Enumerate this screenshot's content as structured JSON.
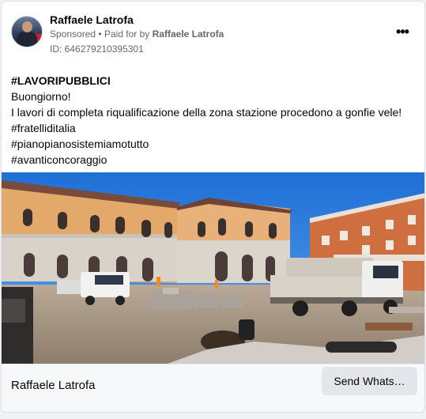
{
  "ad": {
    "page_name": "Raffaele Latrofa",
    "sponsored_label": "Sponsored",
    "paid_for_prefix": "Paid for by",
    "paid_for_name": "Raffaele Latrofa",
    "ad_id": "ID: 646279210395301",
    "more_icon": "more-horizontal-icon"
  },
  "post": {
    "headline": "#LAVORIPUBBLICI",
    "lines": [
      "Buongiorno!",
      "I lavori di completa riqualificazione della zona stazione procedono a gonfie vele!",
      "#fratelliditalia",
      "#pianopianosistemiamotutto",
      "#avanticoncoraggio"
    ]
  },
  "footer": {
    "name": "Raffaele Latrofa",
    "cta_label": "Send Whats…"
  },
  "colors": {
    "text_primary": "#050505",
    "text_secondary": "#65676b",
    "cta_background": "#e4e6eb",
    "footer_background": "#f7f8fa"
  }
}
